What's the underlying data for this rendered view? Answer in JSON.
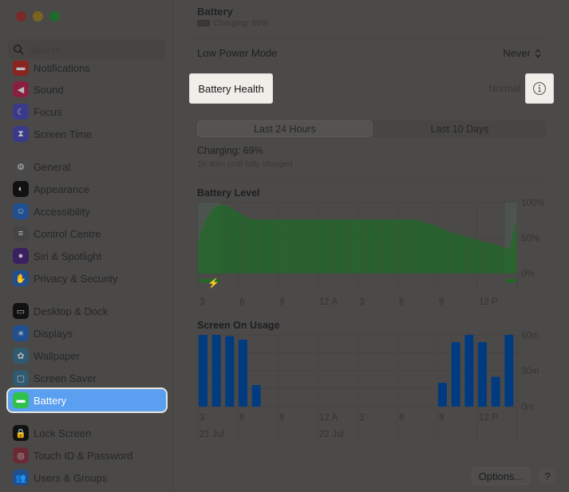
{
  "window": {
    "traffic_lights": [
      "close",
      "minimize",
      "zoom"
    ]
  },
  "sidebar": {
    "search_placeholder": "Search",
    "items": [
      {
        "label": "Notifications",
        "icon": "bell-icon",
        "color": "#8a2420"
      },
      {
        "label": "Sound",
        "icon": "speaker-icon",
        "color": "#8a2040"
      },
      {
        "label": "Focus",
        "icon": "moon-icon",
        "color": "#3a3a8a"
      },
      {
        "label": "Screen Time",
        "icon": "hourglass-icon",
        "color": "#3a3a8a"
      },
      {
        "label": "General",
        "icon": "gear-icon",
        "color": "#4a4a4a"
      },
      {
        "label": "Appearance",
        "icon": "appearance-icon",
        "color": "#111111"
      },
      {
        "label": "Accessibility",
        "icon": "accessibility-icon",
        "color": "#1f4f8f"
      },
      {
        "label": "Control Centre",
        "icon": "control-centre-icon",
        "color": "#444444"
      },
      {
        "label": "Siri & Spotlight",
        "icon": "siri-icon",
        "color": "#3a2060"
      },
      {
        "label": "Privacy & Security",
        "icon": "hand-icon",
        "color": "#1f4f8f"
      },
      {
        "label": "Desktop & Dock",
        "icon": "dock-icon",
        "color": "#111111"
      },
      {
        "label": "Displays",
        "icon": "sun-icon",
        "color": "#1f4f8f"
      },
      {
        "label": "Wallpaper",
        "icon": "flower-icon",
        "color": "#2f5a70"
      },
      {
        "label": "Screen Saver",
        "icon": "screen-saver-icon",
        "color": "#2f5a70"
      },
      {
        "label": "Battery",
        "icon": "battery-icon",
        "color": "#2fc14a",
        "active": true
      },
      {
        "label": "Lock Screen",
        "icon": "lock-icon",
        "color": "#111111"
      },
      {
        "label": "Touch ID & Password",
        "icon": "fingerprint-icon",
        "color": "#6a2a35"
      },
      {
        "label": "Users & Groups",
        "icon": "users-icon",
        "color": "#1f4f8f"
      }
    ]
  },
  "header": {
    "title": "Battery",
    "subtitle": "Charging: 69%"
  },
  "settings": {
    "low_power_mode_label": "Low Power Mode",
    "low_power_mode_value": "Never",
    "battery_health_label": "Battery Health",
    "battery_health_value": "Normal"
  },
  "tabs": [
    {
      "label": "Last 24 Hours",
      "selected": true
    },
    {
      "label": "Last 10 Days",
      "selected": false
    }
  ],
  "status": {
    "charging": "Charging: 69%",
    "time_to_full": "1h 40m until fully charged"
  },
  "footer": {
    "options_label": "Options...",
    "help_label": "?"
  },
  "chart_data": [
    {
      "type": "bar",
      "title": "Battery Level",
      "ylabel": "",
      "ylim": [
        0,
        100
      ],
      "yticks": [
        "100%",
        "50%",
        "0%"
      ],
      "xticks": [
        "3",
        "6",
        "9",
        "12 A",
        "3",
        "6",
        "9",
        "12 P"
      ],
      "bar_color": "#1e6a26",
      "charging_periods_hours": [
        [
          0,
          1.7
        ],
        [
          23.1,
          24
        ]
      ],
      "values": [
        48,
        60,
        66,
        74,
        80,
        85,
        90,
        93,
        95,
        96,
        97,
        97,
        96,
        95,
        93,
        91,
        89,
        87,
        86,
        84,
        82,
        80,
        78,
        77,
        76,
        76,
        76,
        76,
        76,
        76,
        76,
        76,
        76,
        76,
        76,
        76,
        76,
        76,
        76,
        76,
        76,
        76,
        76,
        76,
        76,
        76,
        76,
        76,
        76,
        76,
        76,
        76,
        76,
        76,
        76,
        76,
        76,
        76,
        76,
        76,
        76,
        76,
        76,
        76,
        76,
        76,
        76,
        76,
        76,
        76,
        76,
        76,
        76,
        76,
        76,
        76,
        76,
        76,
        76,
        76,
        76,
        76,
        76,
        76,
        76,
        76,
        76,
        76,
        76,
        76,
        76,
        76,
        76,
        76,
        76,
        76,
        76,
        75,
        74,
        73,
        72,
        71,
        70,
        69,
        68,
        67,
        65,
        64,
        63,
        62,
        60,
        59,
        58,
        57,
        56,
        55,
        54,
        53,
        52,
        51,
        50,
        49,
        48,
        47,
        46,
        45,
        45,
        44,
        44,
        43,
        42,
        41,
        40,
        39,
        38,
        37,
        36,
        35,
        45,
        58,
        69
      ]
    },
    {
      "type": "bar",
      "title": "Screen On Usage",
      "ylabel": "",
      "ylim": [
        0,
        60
      ],
      "yticks": [
        "60m",
        "30m",
        "0m"
      ],
      "xticks": [
        "3",
        "6",
        "9",
        "12 A",
        "3",
        "6",
        "9",
        "12 P"
      ],
      "date_labels": [
        "21 Jul",
        "22 Jul"
      ],
      "bar_color": "#003b80",
      "hours": [
        0,
        1,
        2,
        3,
        4,
        5,
        6,
        7,
        8,
        9,
        10,
        11,
        12,
        13,
        14,
        15,
        16,
        17,
        18,
        19,
        20,
        21,
        22,
        23
      ],
      "values": [
        60,
        60,
        59,
        56,
        18,
        0,
        0,
        0,
        0,
        0,
        0,
        0,
        0,
        0,
        0,
        0,
        0,
        0,
        20,
        54,
        60,
        54,
        25,
        60
      ]
    }
  ]
}
